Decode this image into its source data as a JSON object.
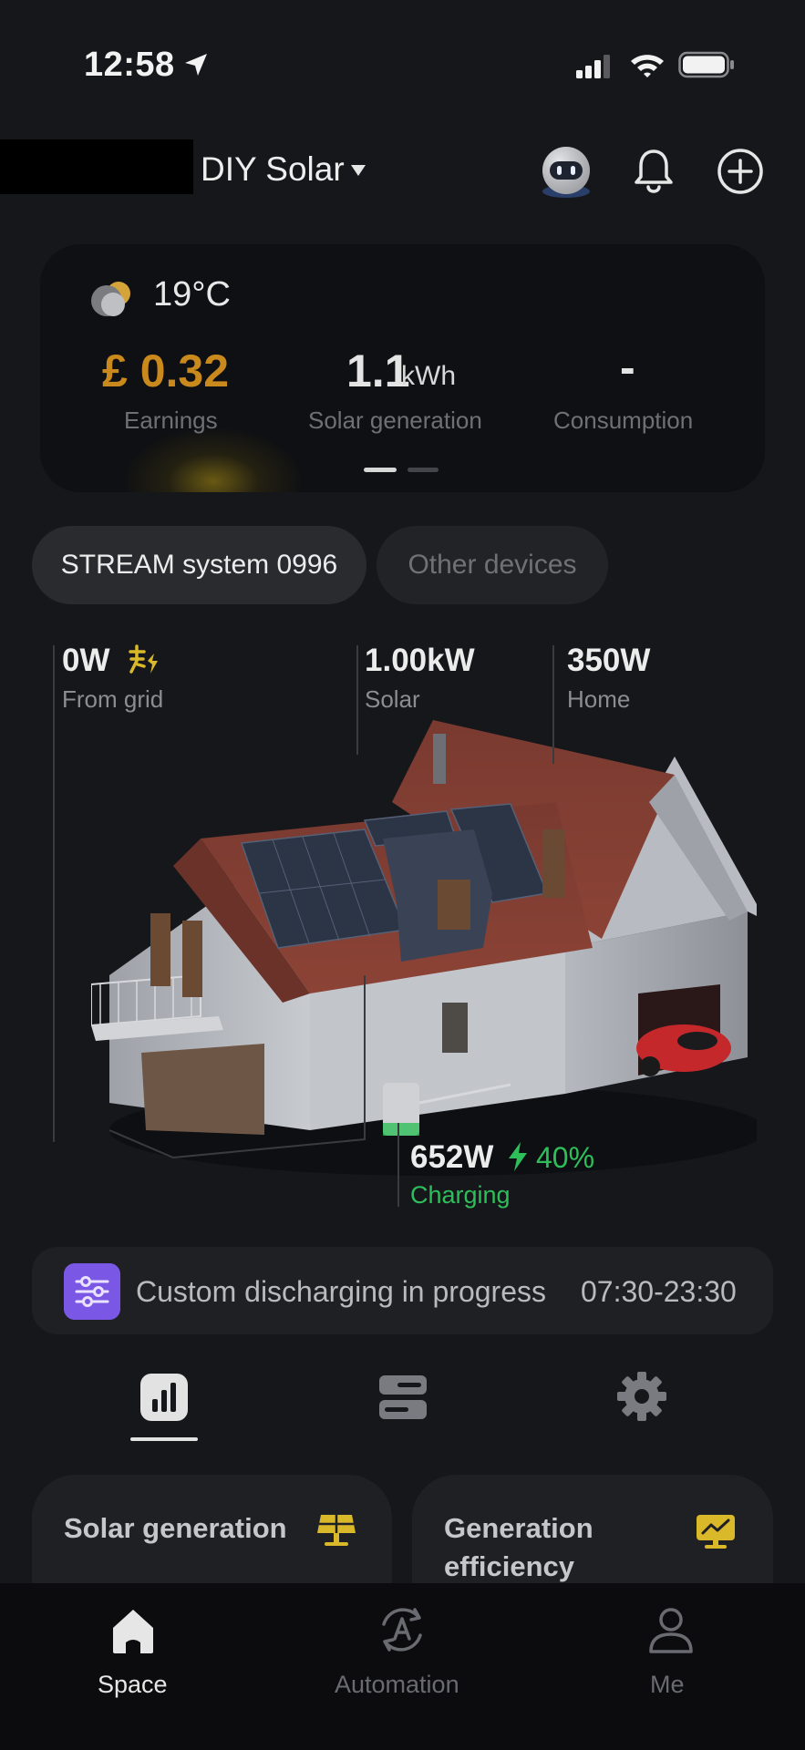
{
  "status_bar": {
    "time": "12:58"
  },
  "header": {
    "space_name": "DIY Solar"
  },
  "weather": {
    "temperature": "19°C"
  },
  "summary": {
    "earnings_value": "£ 0.32",
    "earnings_label": "Earnings",
    "solar_value": "1.1",
    "solar_unit": "kWh",
    "solar_label": "Solar generation",
    "consumption_value": "-",
    "consumption_label": "Consumption"
  },
  "device_tabs": [
    "STREAM system 0996",
    "Other devices"
  ],
  "flow": {
    "grid_value": "0W",
    "grid_label": "From grid",
    "solar_value": "1.00kW",
    "solar_label": "Solar",
    "home_value": "350W",
    "home_label": "Home",
    "battery_value": "652W",
    "battery_percent": "40%",
    "battery_status": "Charging"
  },
  "banner": {
    "text": "Custom discharging in progress",
    "time_range": "07:30-23:30"
  },
  "cards": {
    "left_title": "Solar generation",
    "right_title": "Generation efficiency"
  },
  "bottom_nav": [
    "Space",
    "Automation",
    "Me"
  ],
  "colors": {
    "earnings": "#c9891c",
    "charging": "#2fbf5a",
    "banner_icon": "#7b57e6",
    "solar_icon": "#d9b82a"
  }
}
